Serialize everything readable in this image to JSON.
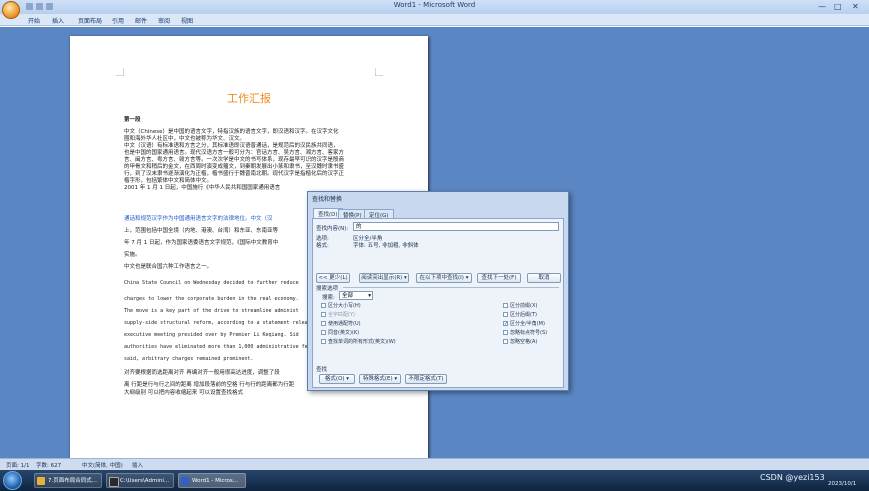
{
  "window": {
    "title": "Word1 - Microsoft Word",
    "controls": [
      "—",
      "□",
      "✕"
    ]
  },
  "ribbon": {
    "tabs": [
      "开始",
      "插入",
      "页面布局",
      "引用",
      "邮件",
      "审阅",
      "视图"
    ]
  },
  "document": {
    "title": "工作汇报",
    "lines": [
      {
        "text": "第一段",
        "style": "bold"
      },
      {
        "text": "中文（Chinese）是中国的语言文字，特指汉族的语言文字，即汉语和汉字。在汉字文化",
        "style": "normal"
      },
      {
        "text": "圈和海外华人社区中，中文也被称为华文、汉文。",
        "style": "normal"
      },
      {
        "text": "中文（汉语）有标准语和方言之分，其标准语即汉语普通话，是规范后的汉民族共同语，",
        "style": "normal"
      },
      {
        "text": "也是中国的国家通用语言。现代汉语方言一般可分为：官话方言、吴方言、湘方言、客家方",
        "style": "normal"
      },
      {
        "text": "言、闽方言、粤方言、赣方言等。一次次学是中文的书写体系，现存最早可识的汉字是殷商",
        "style": "normal"
      },
      {
        "text": "的甲骨文和稍后的金文，在西周时演变成籀文，到秦朝发展出小篆和隶书，至汉魏时隶书盛",
        "style": "normal"
      },
      {
        "text": "行，到了汉末隶书逐渐演化为正楷，楷书盛行于魏晋南北朝。现代汉字是指楷化后的汉字正",
        "style": "normal"
      },
      {
        "text": "楷字形，包括繁体中文和简体中文。",
        "style": "normal"
      },
      {
        "text": "2001 年 1 月 1 日起，中国施行《中华人民共和国国家通用语言",
        "style": "normal"
      },
      {
        "text": "通话和规范汉字作为中国通用语言文字的法律地位。中文（汉",
        "style": "blue"
      },
      {
        "text": "上，范围包括中国全境（内地、港澳、台湾）和东亚、东南亚等",
        "style": "normal"
      },
      {
        "text": "年 7 月 1 日起，作为国家语委语言文字规范，《国际中文教育中",
        "style": "normal"
      },
      {
        "text": "实施。",
        "style": "normal"
      },
      {
        "text": "中文也是联合国六种工作语言之一。",
        "style": "normal"
      },
      {
        "text": "China State Council on Wednesday decided to further reduce",
        "style": "mono"
      },
      {
        "text": "charges to lower the corporate burden in the real economy.",
        "style": "mono"
      },
      {
        "text": "The move is a key part of the drive to streamline administ",
        "style": "mono"
      },
      {
        "text": "supply-side structural reform, according to a statement releas",
        "style": "mono"
      },
      {
        "text": "executive meeting presided over by Premier Li Keqiang. Sid",
        "style": "mono"
      },
      {
        "text": "authorities have eliminated more than 1,000 administrative fee",
        "style": "mono"
      },
      {
        "text": "said, arbitrary charges remained prominent.",
        "style": "mono"
      },
      {
        "text": "对齐要根据而选距离对齐    再编对齐一般用很高达进度，调整了段",
        "style": "normal"
      },
      {
        "text": "离      行距是行与行之间的距离      增加段落前的空格   行与行的距离都为行距",
        "style": "normal"
      },
      {
        "text": "大纲级别   可以把内容收缩起来    可以设置查找格式",
        "style": "normal"
      }
    ]
  },
  "dialog": {
    "title": "查找和替换",
    "tabs": [
      "查找(D)",
      "替换(P)",
      "定位(G)"
    ],
    "find_label": "查找内容(N):",
    "find_value": "的",
    "options_label": "选项:",
    "options_value": "区分全/半角",
    "format_label": "格式:",
    "format_value": "字体: 五号, 非加粗, 非斜体",
    "buttons": {
      "less": "<< 更少(L)",
      "highlight": "阅读突出显示(R) ▾",
      "find_in": "在以下项中查找(I) ▾",
      "find_next": "查找下一处(F)",
      "cancel": "取消"
    },
    "search_options_title": "搜索选项",
    "search_label": "搜索:",
    "search_value": "全部",
    "checkboxes_left": [
      {
        "label": "区分大小写(H)",
        "checked": false,
        "disabled": false
      },
      {
        "label": "全字匹配(Y)",
        "checked": false,
        "disabled": true
      },
      {
        "label": "使用通配符(U)",
        "checked": false,
        "disabled": false
      },
      {
        "label": "同音(英文)(K)",
        "checked": false,
        "disabled": false
      },
      {
        "label": "查找单词的所有形式(英文)(W)",
        "checked": false,
        "disabled": false
      }
    ],
    "checkboxes_right": [
      {
        "label": "区分前缀(X)",
        "checked": false,
        "disabled": false
      },
      {
        "label": "区分后缀(T)",
        "checked": false,
        "disabled": false
      },
      {
        "label": "区分全/半角(M)",
        "checked": true,
        "disabled": false
      },
      {
        "label": "忽略标点符号(S)",
        "checked": false,
        "disabled": false
      },
      {
        "label": "忽略空格(A)",
        "checked": false,
        "disabled": false
      }
    ],
    "find_section_title": "查找",
    "bottom_buttons": [
      "格式(O) ▾",
      "特殊格式(E) ▾",
      "不限定格式(T)"
    ]
  },
  "statusbar": {
    "page": "页面: 1/1",
    "words": "字数: 627",
    "lang": "中文(简体, 中国)",
    "mode": "插入"
  },
  "taskbar": {
    "items": [
      "7.页面布局合同式...",
      "C:\\Users\\Admini...",
      "Word1 - Micros..."
    ],
    "time": "",
    "date": "2023/10/1",
    "watermark": "CSDN @yezi153"
  },
  "colors": {
    "accent_orange": "#f08a1e",
    "link_blue": "#1f57c9",
    "workspace": "#5b86c4"
  }
}
